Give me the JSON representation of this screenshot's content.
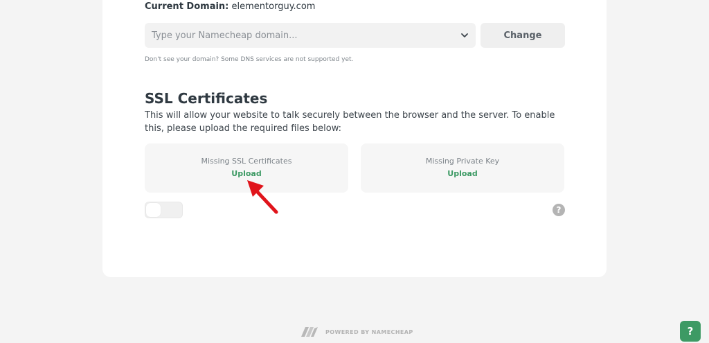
{
  "domain": {
    "current_label": "Current Domain:",
    "current_value": "elementorguy.com",
    "select_placeholder": "Type your Namecheap domain...",
    "change_label": "Change",
    "hint": "Don't see your domain? Some DNS services are not supported yet."
  },
  "ssl": {
    "title": "SSL Certificates",
    "description": "This will allow your website to talk securely between the browser and the server. To enable this, please upload the required files below:",
    "boxes": [
      {
        "missing_label": "Missing SSL Certificates",
        "upload_label": "Upload"
      },
      {
        "missing_label": "Missing Private Key",
        "upload_label": "Upload"
      }
    ],
    "toggle_on": false,
    "help_glyph": "?"
  },
  "footer": {
    "powered_by": "POWERED BY NAMECHEAP"
  },
  "chat": {
    "glyph": "?"
  },
  "colors": {
    "accent_green": "#3d9a64",
    "arrow_red": "#e0141b"
  }
}
